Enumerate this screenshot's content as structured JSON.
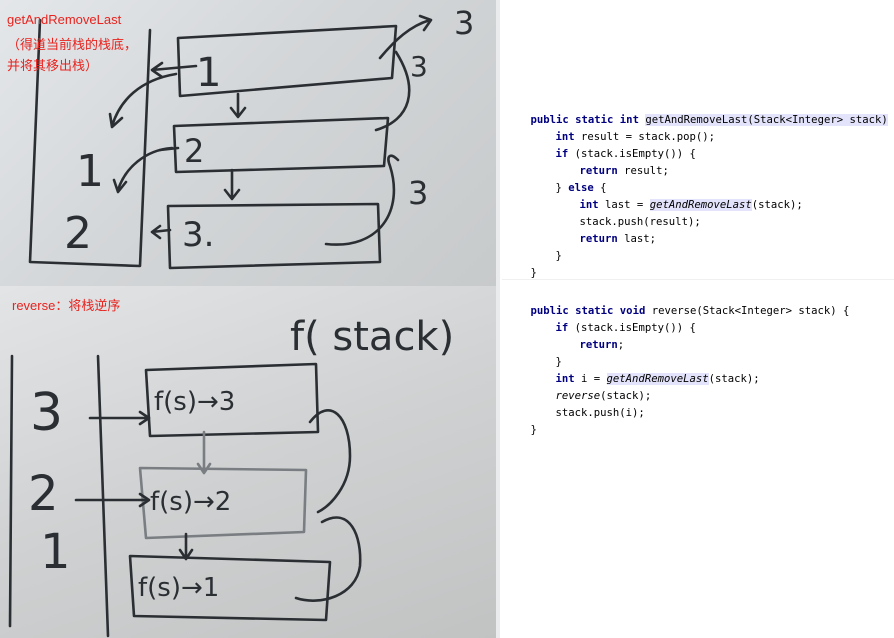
{
  "captions": {
    "top_title": "getAndRemoveLast",
    "top_line2": "（得道当前栈的栈底，",
    "top_line3": "并将其移出栈）",
    "bottom_title": "reverse：将栈逆序"
  },
  "whiteboard_top": {
    "stack_labels": [
      "1",
      "2"
    ],
    "frame_labels": [
      "1",
      "2",
      "3."
    ],
    "return_labels": [
      "3",
      "3",
      "3"
    ]
  },
  "whiteboard_bottom": {
    "heading": "f( stack)",
    "stack_labels": [
      "3",
      "2",
      "1"
    ],
    "frame_labels": [
      "f(s)→3",
      "f(s)→2",
      "f(s)→1"
    ]
  },
  "code_top": {
    "line1": {
      "kw": "public static int",
      "name": "getAndRemoveLast",
      "params": "(Stack<Integer> stack)",
      "brace": " {"
    },
    "line2": {
      "kw": "int",
      "rest": " result = stack.pop();"
    },
    "line3": {
      "kw": "if",
      "rest": " (stack.isEmpty()) {"
    },
    "line4": {
      "kw": "return",
      "rest": " result;"
    },
    "line5": {
      "pre": "} ",
      "kw": "else",
      "rest": " {"
    },
    "line6": {
      "kw": "int",
      "mid": " last = ",
      "call": "getAndRemoveLast",
      "rest": "(stack);"
    },
    "line7": {
      "text": "stack.push(result);"
    },
    "line8": {
      "kw": "return",
      "rest": " last;"
    },
    "line9": {
      "text": "}"
    },
    "line10": {
      "text": "}"
    }
  },
  "code_bottom": {
    "line1": {
      "kw": "public static void",
      "rest": " reverse(Stack<Integer> stack) {"
    },
    "line2": {
      "kw": "if",
      "rest": " (stack.isEmpty()) {"
    },
    "line3": {
      "kw": "return",
      "rest": ";"
    },
    "line4": {
      "text": "}"
    },
    "line5": {
      "kw": "int",
      "mid": " i = ",
      "call": "getAndRemoveLast",
      "rest": "(stack);"
    },
    "line6": {
      "call": "reverse",
      "rest": "(stack);"
    },
    "line7": {
      "text": "stack.push(i);"
    },
    "line8": {
      "text": "}"
    }
  }
}
